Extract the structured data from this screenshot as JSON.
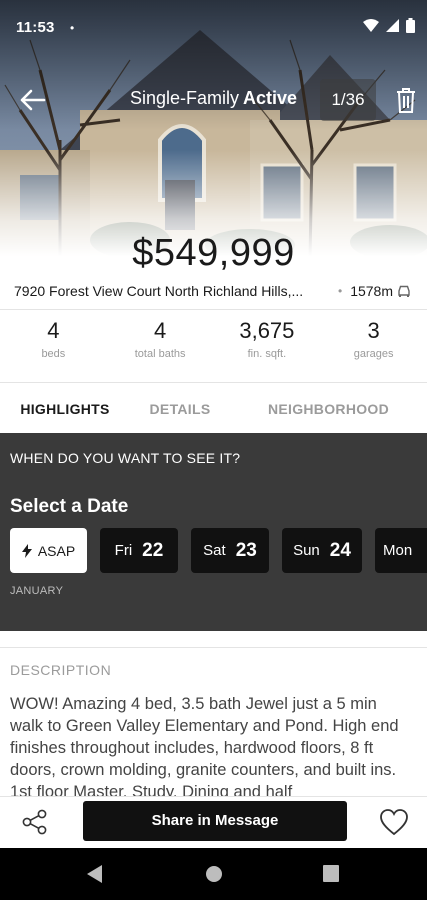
{
  "status_bar": {
    "time": "11:53",
    "notification_dot": "•"
  },
  "header": {
    "listing_type": "Single-Family",
    "listing_status": "Active",
    "photo_counter": "1/36"
  },
  "listing": {
    "price": "$549,999",
    "address": "7920 Forest View Court North Richland Hills,...",
    "separator": "•",
    "distance": "1578m"
  },
  "stats": [
    {
      "value": "4",
      "label": "beds"
    },
    {
      "value": "4",
      "label": "total baths"
    },
    {
      "value": "3,675",
      "label": "fin. sqft."
    },
    {
      "value": "3",
      "label": "garages"
    }
  ],
  "tabs": [
    {
      "label": "HIGHLIGHTS",
      "active": true
    },
    {
      "label": "DETAILS",
      "active": false
    },
    {
      "label": "NEIGHBORHOOD",
      "active": false
    }
  ],
  "schedule": {
    "question": "WHEN DO YOU WANT TO SEE IT?",
    "title": "Select a Date",
    "asap_label": "ASAP",
    "dates": [
      {
        "dow": "Fri",
        "day": "22"
      },
      {
        "dow": "Sat",
        "day": "23"
      },
      {
        "dow": "Sun",
        "day": "24"
      },
      {
        "dow": "Mon",
        "day": ""
      }
    ],
    "month": "JANUARY"
  },
  "description": {
    "label": "DESCRIPTION",
    "text": "WOW! Amazing 4 bed, 3.5 bath Jewel just a 5 min walk to Green Valley Elementary and Pond. High end finishes throughout includes, hardwood floors, 8 ft doors, crown molding, granite counters, and built ins. 1st floor Master, Study, Dining and half"
  },
  "actions": {
    "share_message_label": "Share in Message"
  },
  "icons": {
    "back": "arrow-left-icon",
    "trash": "trash-icon",
    "car": "car-icon",
    "bolt": "lightning-icon",
    "share": "share-icon",
    "favorite": "heart-icon"
  },
  "colors": {
    "schedule_bg": "#3a3a3a",
    "chip_bg": "#111111",
    "primary_button": "#111111",
    "muted_text": "#9b9b9b"
  }
}
